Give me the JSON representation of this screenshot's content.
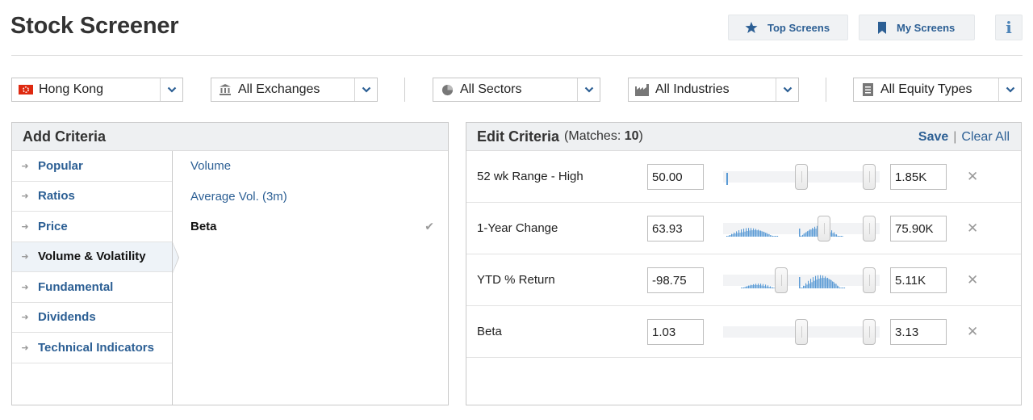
{
  "header": {
    "title": "Stock Screener",
    "top_screens_label": "Top Screens",
    "my_screens_label": "My Screens",
    "info_label": "i"
  },
  "filters": {
    "region": "Hong Kong",
    "exchange": "All Exchanges",
    "sector": "All Sectors",
    "industry": "All Industries",
    "equity_type": "All Equity Types"
  },
  "add_criteria": {
    "title": "Add Criteria",
    "categories": [
      {
        "label": "Popular",
        "selected": false
      },
      {
        "label": "Ratios",
        "selected": false
      },
      {
        "label": "Price",
        "selected": false
      },
      {
        "label": "Volume & Volatility",
        "selected": true
      },
      {
        "label": "Fundamental",
        "selected": false
      },
      {
        "label": "Dividends",
        "selected": false
      },
      {
        "label": "Technical Indicators",
        "selected": false
      }
    ],
    "criteria": [
      {
        "label": "Volume",
        "active": false
      },
      {
        "label": "Average Vol. (3m)",
        "active": false
      },
      {
        "label": "Beta",
        "active": true
      }
    ]
  },
  "edit_criteria": {
    "title": "Edit Criteria",
    "matches_prefix": "(Matches: ",
    "matches_count": "10",
    "matches_suffix": ")",
    "save_label": "Save",
    "separator": "|",
    "clear_all_label": "Clear All",
    "rows": [
      {
        "label": "52 wk Range - High",
        "min": "50.00",
        "max": "1.85K",
        "min_handle": 0.5,
        "max_handle": 0.97
      },
      {
        "label": "1-Year Change",
        "min": "63.93",
        "max": "75.90K",
        "min_handle": 0.66,
        "max_handle": 0.97
      },
      {
        "label": "YTD % Return",
        "min": "-98.75",
        "max": "5.11K",
        "min_handle": 0.36,
        "max_handle": 0.97
      },
      {
        "label": "Beta",
        "min": "1.03",
        "max": "3.13",
        "min_handle": 0.5,
        "max_handle": 0.97
      }
    ]
  },
  "colors": {
    "link": "#2c5f94",
    "histogram": "#5b9bd5",
    "panel_header": "#eef0f2",
    "flag_red": "#de2910"
  }
}
